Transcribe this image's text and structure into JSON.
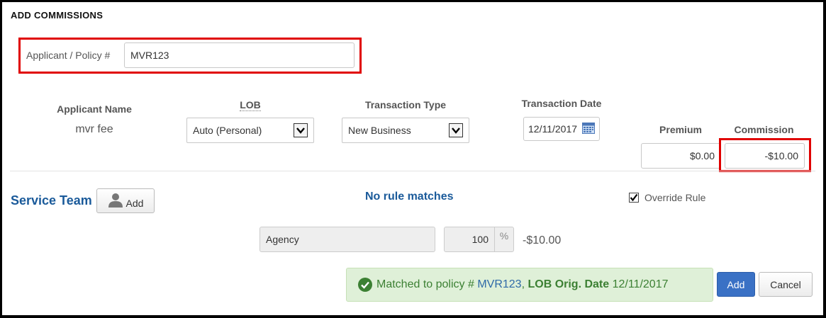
{
  "header": {
    "title": "ADD COMMISSIONS"
  },
  "applicant_policy": {
    "label": "Applicant / Policy #",
    "value": "MVR123"
  },
  "applicant_name": {
    "label": "Applicant Name",
    "value": "mvr fee"
  },
  "lob": {
    "label": "LOB",
    "value": "Auto (Personal)"
  },
  "transaction_type": {
    "label": "Transaction Type",
    "value": "New Business"
  },
  "transaction_date": {
    "label": "Transaction Date",
    "value": "12/11/2017"
  },
  "premium": {
    "label": "Premium",
    "value": "$0.00"
  },
  "commission": {
    "label": "Commission",
    "value": "-$10.00"
  },
  "service_team": {
    "title": "Service Team",
    "add_label": "Add"
  },
  "rule_status": "No rule matches",
  "override_rule": {
    "label": "Override Rule",
    "checked": true
  },
  "split": {
    "name": "Agency",
    "percent": "100",
    "percent_symbol": "%",
    "amount": "-$10.00"
  },
  "alert": {
    "prefix": "Matched to policy #",
    "policy": "MVR123",
    "separator": ",",
    "lob_label": "LOB Orig. Date",
    "date": "12/11/2017"
  },
  "actions": {
    "add_label": "Add",
    "cancel_label": "Cancel"
  },
  "colors": {
    "highlight": "#e00000",
    "link": "#1a5a9a",
    "primary": "#3a71c5",
    "success_bg": "#dff0d8"
  },
  "icons": {
    "select_arrow": "chevron-down-icon",
    "calendar": "calendar-icon",
    "user": "user-icon",
    "check": "check-circle-icon"
  }
}
